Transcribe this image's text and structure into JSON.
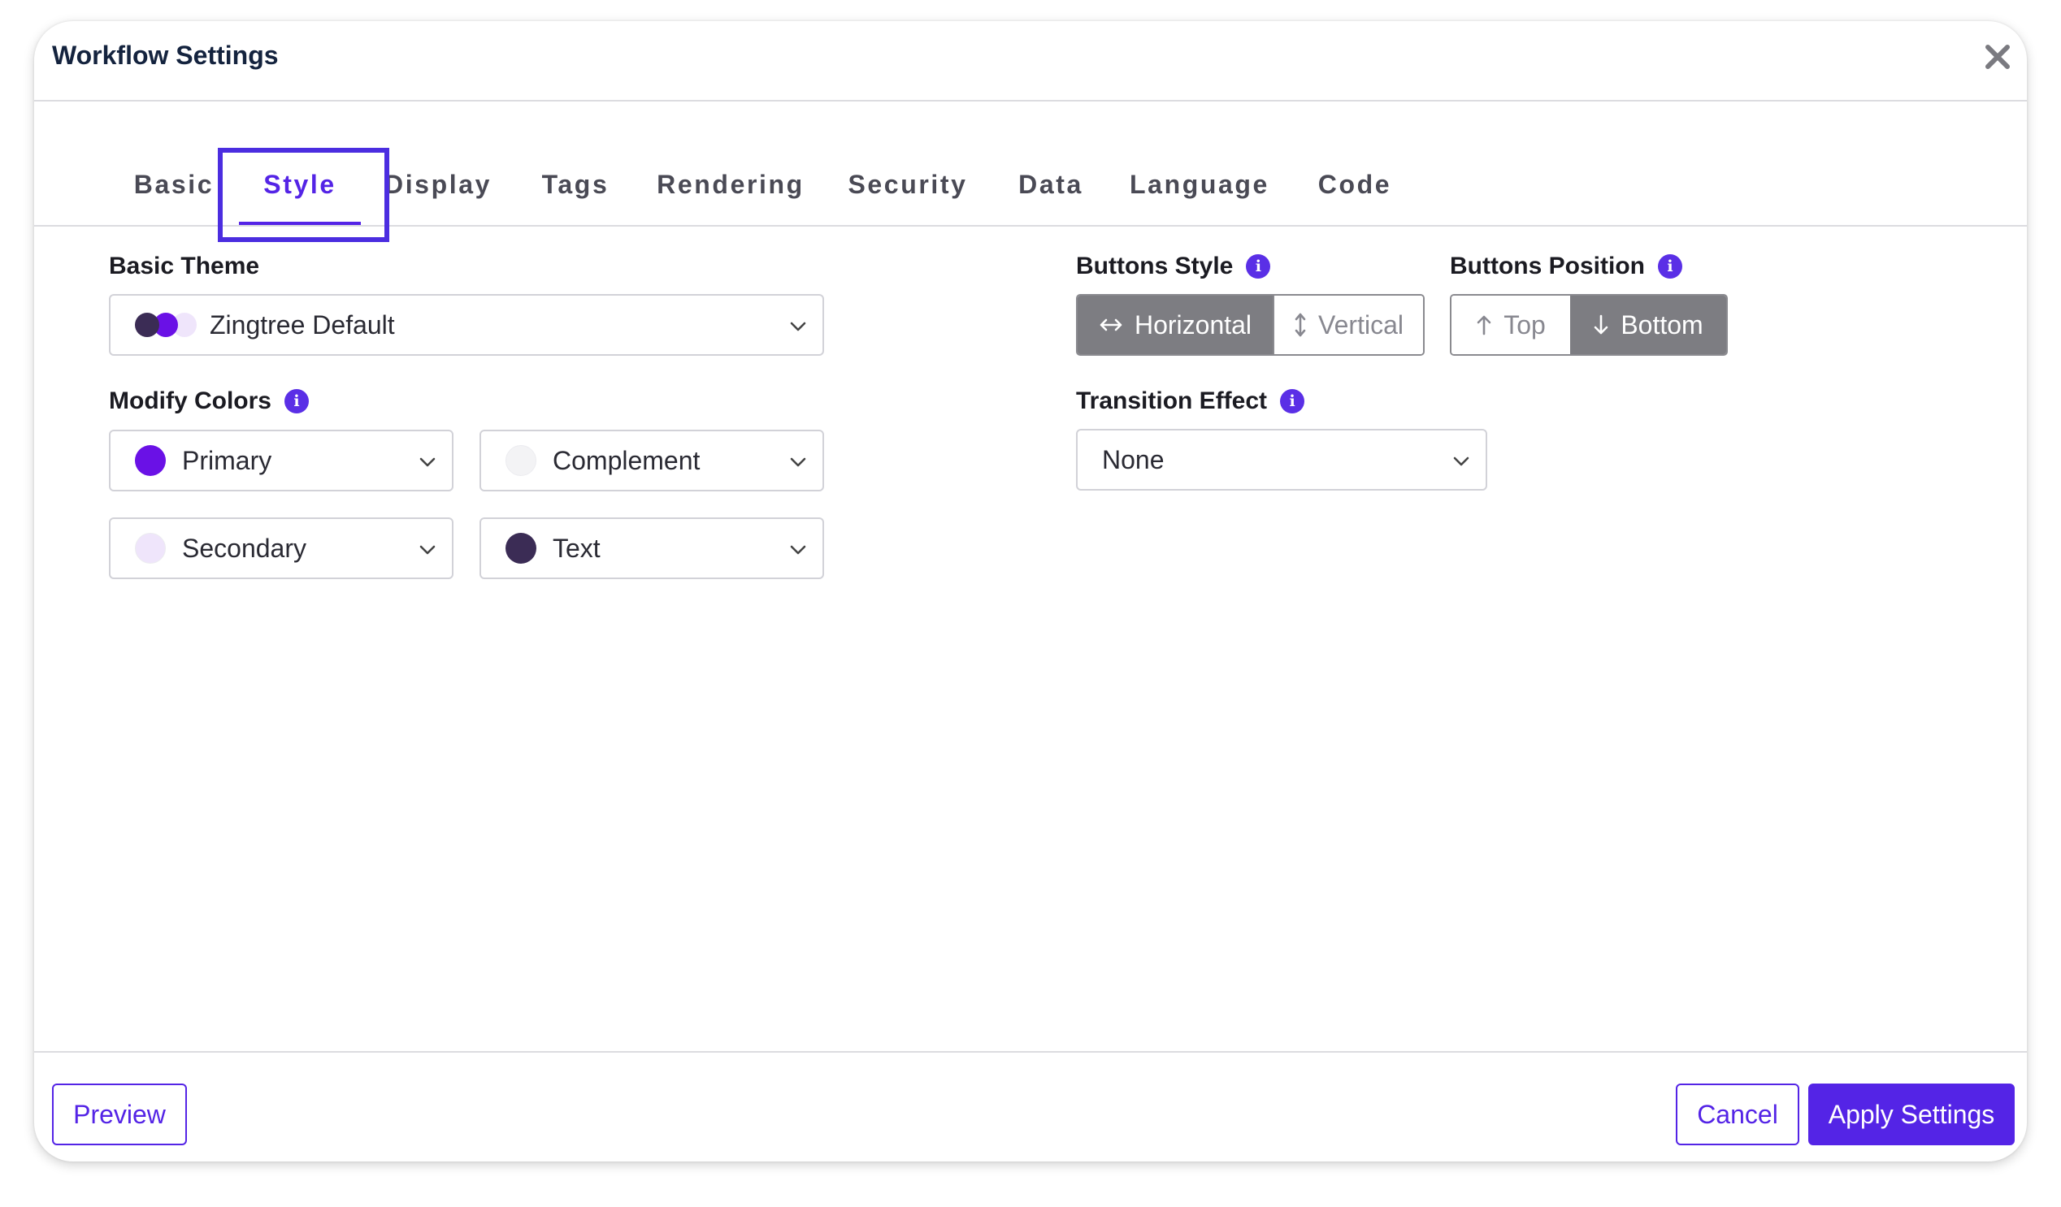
{
  "dialog": {
    "title": "Workflow Settings",
    "close_icon": "close-icon"
  },
  "tabs": [
    {
      "label": "Basic"
    },
    {
      "label": "Style"
    },
    {
      "label": "Display"
    },
    {
      "label": "Tags"
    },
    {
      "label": "Rendering"
    },
    {
      "label": "Security"
    },
    {
      "label": "Data"
    },
    {
      "label": "Language"
    },
    {
      "label": "Code"
    }
  ],
  "active_tab": "Style",
  "basic_theme": {
    "label": "Basic Theme",
    "value": "Zingtree Default",
    "swatches": [
      "#3b2c55",
      "#6a11e6",
      "#efe5fb"
    ]
  },
  "modify_colors": {
    "label": "Modify Colors",
    "fields": [
      {
        "value": "Primary",
        "color": "#6a11e6"
      },
      {
        "value": "Complement",
        "color": "#f3f3f5"
      },
      {
        "value": "Secondary",
        "color": "#efe5fb"
      },
      {
        "value": "Text",
        "color": "#3b2c55"
      }
    ]
  },
  "buttons_style": {
    "label": "Buttons Style",
    "options": [
      {
        "label": "Horizontal",
        "selected": true
      },
      {
        "label": "Vertical",
        "selected": false
      }
    ]
  },
  "buttons_position": {
    "label": "Buttons Position",
    "options": [
      {
        "label": "Top",
        "selected": false
      },
      {
        "label": "Bottom",
        "selected": true
      }
    ]
  },
  "transition_effect": {
    "label": "Transition Effect",
    "value": "None"
  },
  "footer": {
    "preview": "Preview",
    "cancel": "Cancel",
    "apply": "Apply Settings"
  },
  "colors": {
    "accent": "#5424e6",
    "segment_selected": "#7d7d82",
    "title": "#14233e"
  }
}
